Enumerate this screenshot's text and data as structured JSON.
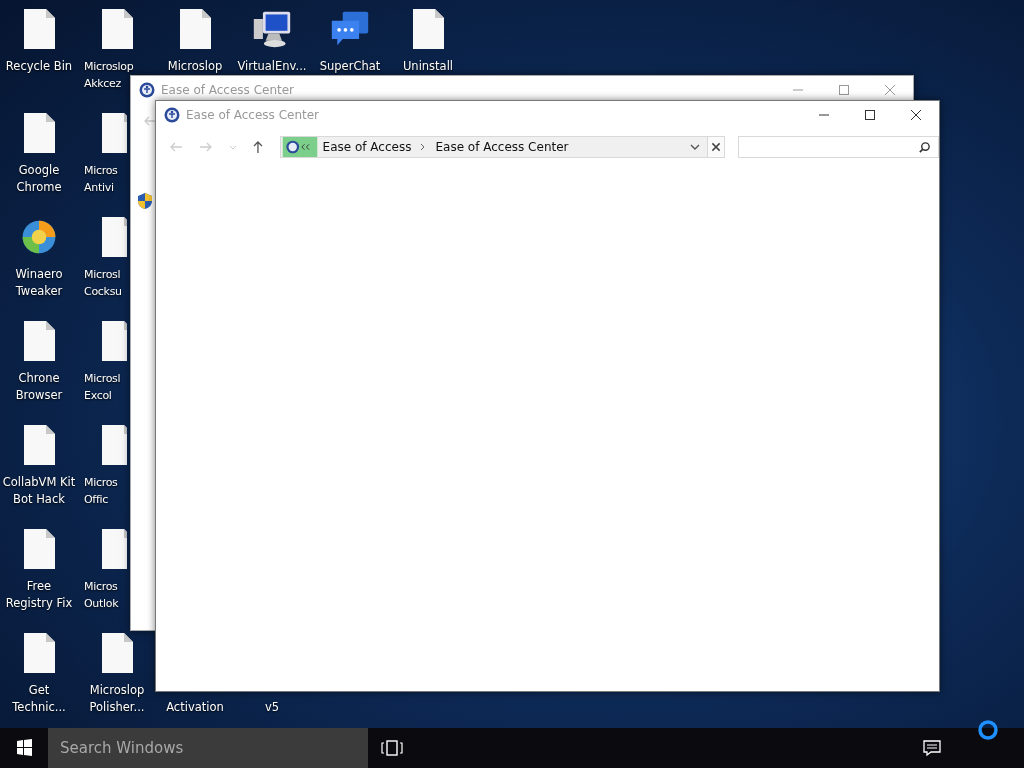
{
  "desktop": {
    "icons": [
      {
        "label": "Recycle Bin",
        "kind": "file"
      },
      {
        "label": "Microslop\nAkkcez",
        "kind": "file"
      },
      {
        "label": "Microslop",
        "kind": "file"
      },
      {
        "label": "VirtualEnv...",
        "kind": "monitor"
      },
      {
        "label": "SuperChat",
        "kind": "chat"
      },
      {
        "label": "Uninstall",
        "kind": "file"
      },
      {
        "label": "Google\nChrome",
        "kind": "file"
      },
      {
        "label": "Micros\nAntivi",
        "kind": "file"
      },
      {
        "label": "Winaero\nTweaker",
        "kind": "swirl"
      },
      {
        "label": "Microsl\nCocksu",
        "kind": "file"
      },
      {
        "label": "Chrone\nBrowser",
        "kind": "file"
      },
      {
        "label": "Microsl\nExcol",
        "kind": "file"
      },
      {
        "label": "CollabVM Kit\nBot Hack",
        "kind": "file"
      },
      {
        "label": "Micros\nOffic",
        "kind": "file"
      },
      {
        "label": "Free\nRegistry Fix",
        "kind": "file"
      },
      {
        "label": "Micros\nOutlok",
        "kind": "file"
      },
      {
        "label": "Get\nTechnic...",
        "kind": "file"
      },
      {
        "label": "Microslop\nPolisher...",
        "kind": "file"
      },
      {
        "label": "Activation",
        "kind": "covered"
      },
      {
        "label": "v5",
        "kind": "covered"
      }
    ]
  },
  "windows": [
    {
      "title": "Ease of Access Center"
    },
    {
      "title": "Ease of Access Center",
      "nav": [
        {
          "kind": "back",
          "disabled": true
        },
        {
          "kind": "forward",
          "disabled": true
        },
        {
          "kind": "recent",
          "disabled": true
        },
        {
          "kind": "up",
          "disabled": false
        }
      ],
      "address": [
        "Ease of Access",
        "Ease of Access Center"
      ]
    }
  ],
  "taskbar": {
    "search": {
      "placeholder": "Search Windows"
    }
  }
}
